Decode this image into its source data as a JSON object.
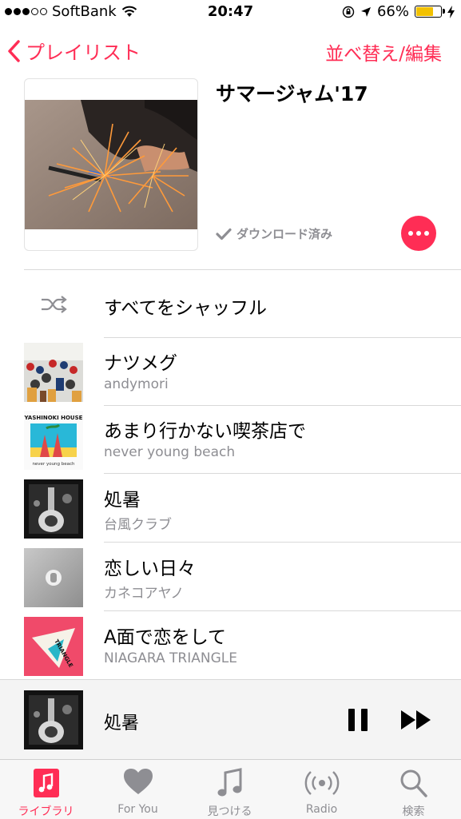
{
  "status": {
    "carrier": "SoftBank",
    "time": "20:47",
    "battery": "66%"
  },
  "nav": {
    "back_label": "プレイリスト",
    "edit_label": "並べ替え/編集"
  },
  "playlist": {
    "title": "サマージャム'17",
    "download_status": "ダウンロード済み"
  },
  "shuffle": {
    "label": "すべてをシャッフル"
  },
  "songs": [
    {
      "title": "ナツメグ",
      "artist": "andymori"
    },
    {
      "title": "あまり行かない喫茶店で",
      "artist": "never young beach"
    },
    {
      "title": "処暑",
      "artist": "台風クラブ"
    },
    {
      "title": "恋しい日々",
      "artist": "カネコアヤノ"
    },
    {
      "title": "A面で恋をして",
      "artist": "NIAGARA TRIANGLE"
    }
  ],
  "album_art_text": {
    "yashinoki": "YASHINOKI HOUSE",
    "nyb": "never young beach",
    "triangle": "TRIANGLE"
  },
  "now_playing": {
    "title": "処暑"
  },
  "tabs": [
    {
      "label": "ライブラリ",
      "icon": "library-icon",
      "active": true
    },
    {
      "label": "For You",
      "icon": "heart-icon",
      "active": false
    },
    {
      "label": "見つける",
      "icon": "music-note-icon",
      "active": false
    },
    {
      "label": "Radio",
      "icon": "radio-icon",
      "active": false
    },
    {
      "label": "検索",
      "icon": "search-icon",
      "active": false
    }
  ],
  "colors": {
    "accent": "#ff2d55",
    "secondary_text": "#8e8e93",
    "battery": "#f2c100"
  }
}
